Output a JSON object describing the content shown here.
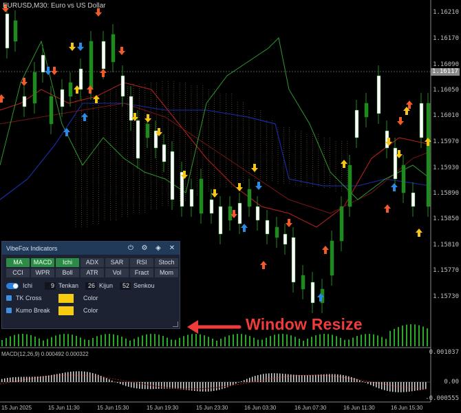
{
  "chart": {
    "title": "EURUSD,M30:  Euro vs US Dollar",
    "price_labels": [
      "1.16210",
      "1.16170",
      "1.16090",
      "1.16050",
      "1.16010",
      "1.15970",
      "1.15930",
      "1.15890",
      "1.15850",
      "1.15810",
      "1.15770",
      "1.15730"
    ],
    "current_price": "1.16117",
    "time_labels": [
      "15 Jun 2025",
      "15 Jun 11:30",
      "15 Jun 15:30",
      "15 Jun 19:30",
      "15 Jun 23:30",
      "16 Jun 03:30",
      "16 Jun 07:30",
      "16 Jun 11:30",
      "16 Jun 15:30"
    ],
    "macd_title": "MACD(12,26,9) 0.000492 0.000322",
    "macd_labels": [
      "0.001037",
      "0.00",
      "-0.000555"
    ]
  },
  "panel": {
    "title": "VibeFox Indicators",
    "tabs": [
      "MA",
      "MACD",
      "Ichi",
      "ADX",
      "SAR",
      "RSI",
      "Stoch",
      "CCI",
      "WPR",
      "Boll",
      "ATR",
      "Vol",
      "Fract",
      "Mom"
    ],
    "active_tabs": [
      "MA",
      "MACD",
      "Ichi"
    ],
    "ichi_label": "Ichi",
    "tenkan_value": "9",
    "tenkan_label": "Tenkan",
    "kijun_value": "26",
    "kijun_label": "Kijun",
    "senkou_value": "52",
    "senkou_label": "Senkou",
    "tk_cross_label": "TK Cross",
    "kumo_break_label": "Kumo Break",
    "color_label": "Color",
    "swatch_color": "#f5cc12"
  },
  "annotation": {
    "text": "Window Resize",
    "color": "#ef3b3b"
  }
}
